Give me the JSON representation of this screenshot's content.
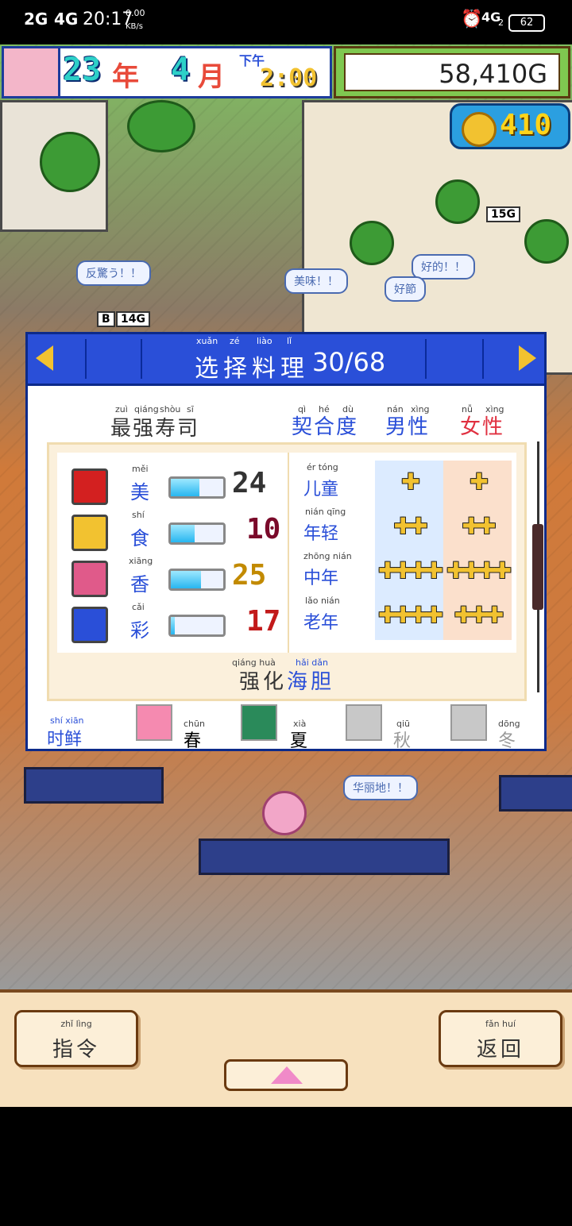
{
  "status_bar": {
    "network_1": "2G",
    "network_2": "4G",
    "time": "20:17",
    "speed_value": "0.00",
    "speed_unit": "KB/s",
    "right_network": "4G",
    "right_network_sub": "2",
    "battery": "62"
  },
  "hud": {
    "year": "23",
    "year_unit": "年",
    "month": "4",
    "month_unit": "月",
    "period": "下午",
    "clock": "2:00",
    "money": "58,410G",
    "coins": "410"
  },
  "world": {
    "bubbles": [
      "反驚う！！",
      "美味！！",
      "好的！！",
      "好節",
      "华丽地！！"
    ],
    "chips": [
      "15G",
      "14G"
    ],
    "chip_prefix": "B"
  },
  "panel": {
    "title": "选择料理",
    "title_pinyin": [
      "xuǎn",
      "zé",
      "liào",
      "lǐ"
    ],
    "count": "30/68",
    "sushi_name": "最强寿司",
    "sushi_name_pinyin": [
      "zuì",
      "qiáng",
      "shòu",
      "sī"
    ],
    "affinity_header": "契合度",
    "affinity_pinyin": [
      "qì",
      "hé",
      "dù"
    ],
    "male_header": "男性",
    "male_pinyin": [
      "nán",
      "xìng"
    ],
    "female_header": "女性",
    "female_pinyin": [
      "nǚ",
      "xìng"
    ],
    "stats": [
      {
        "label": "美",
        "pinyin": "měi",
        "value": "24",
        "fill": 0.55,
        "color": "#d32020",
        "val_color": "#333333"
      },
      {
        "label": "食",
        "pinyin": "shí",
        "value": "10",
        "fill": 0.45,
        "color": "#f2c230",
        "val_color": "#7a0a2a"
      },
      {
        "label": "香",
        "pinyin": "xiāng",
        "value": "25",
        "fill": 0.58,
        "color": "#e05a8a",
        "val_color": "#c28a00"
      },
      {
        "label": "彩",
        "pinyin": "cǎi",
        "value": "17",
        "fill": 0.08,
        "color": "#2a4fd8",
        "val_color": "#c21a1a"
      }
    ],
    "age_groups": [
      {
        "label": "儿童",
        "pinyin": "ér tóng",
        "male": "✚",
        "female": "✚"
      },
      {
        "label": "年轻",
        "pinyin": "nián qīng",
        "male": "✚✚",
        "female": "✚✚"
      },
      {
        "label": "中年",
        "pinyin": "zhōng nián",
        "male": "✚✚✚✚",
        "female": "✚✚✚✚"
      },
      {
        "label": "老年",
        "pinyin": "lǎo nián",
        "male": "✚✚✚✚",
        "female": "✚✚✚"
      }
    ],
    "enhance_prefix": "强化",
    "enhance_prefix_pinyin": "qiáng huà",
    "enhance_item": "海胆",
    "enhance_item_pinyin": "hǎi dǎn",
    "season_label": "时鲜",
    "season_label_pinyin": "shí xiān",
    "seasons": [
      {
        "label": "春",
        "pinyin": "chūn",
        "active": true,
        "color": "#f58ab0"
      },
      {
        "label": "夏",
        "pinyin": "xià",
        "active": true,
        "color": "#2a8a5a"
      },
      {
        "label": "秋",
        "pinyin": "qiū",
        "active": false,
        "color": "#c8c8c8"
      },
      {
        "label": "冬",
        "pinyin": "dōng",
        "active": false,
        "color": "#c8c8c8"
      }
    ]
  },
  "commands": {
    "order_label": "指令",
    "order_pinyin": "zhǐ lìng",
    "back_label": "返回",
    "back_pinyin": "fǎn huí"
  }
}
